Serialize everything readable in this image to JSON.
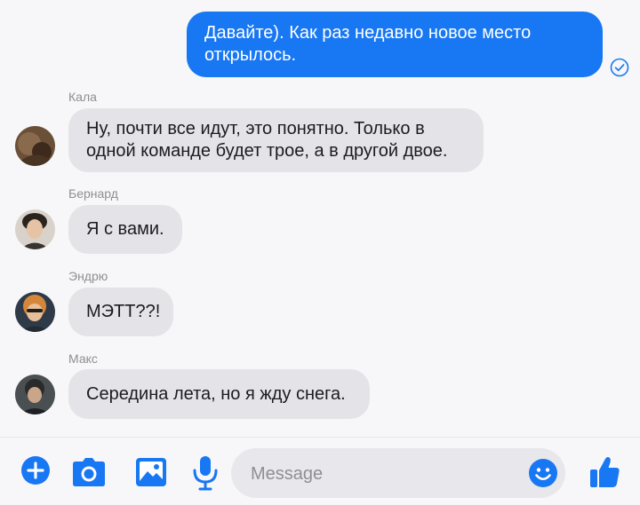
{
  "colors": {
    "accent": "#1877f2",
    "incoming_bubble": "#e4e4e8",
    "background": "#f7f7fa"
  },
  "messages": [
    {
      "direction": "outgoing",
      "text": "Давайте). Как раз недавно новое место открылось.",
      "status_icon": "check-circle-icon"
    },
    {
      "direction": "incoming",
      "sender": "Кала",
      "text": "Ну, почти все идут, это понятно. Только в одной команде будет трое, а в другой двое."
    },
    {
      "direction": "incoming",
      "sender": "Бернард",
      "text": "Я с вами."
    },
    {
      "direction": "incoming",
      "sender": "Эндрю",
      "text": "МЭТТ??!"
    },
    {
      "direction": "incoming",
      "sender": "Макс",
      "text": "Середина лета, но я жду снега."
    }
  ],
  "composer": {
    "placeholder": "Message",
    "icons": [
      "plus-icon",
      "camera-icon",
      "image-icon",
      "microphone-icon",
      "emoji-icon",
      "thumbs-up-icon"
    ]
  }
}
